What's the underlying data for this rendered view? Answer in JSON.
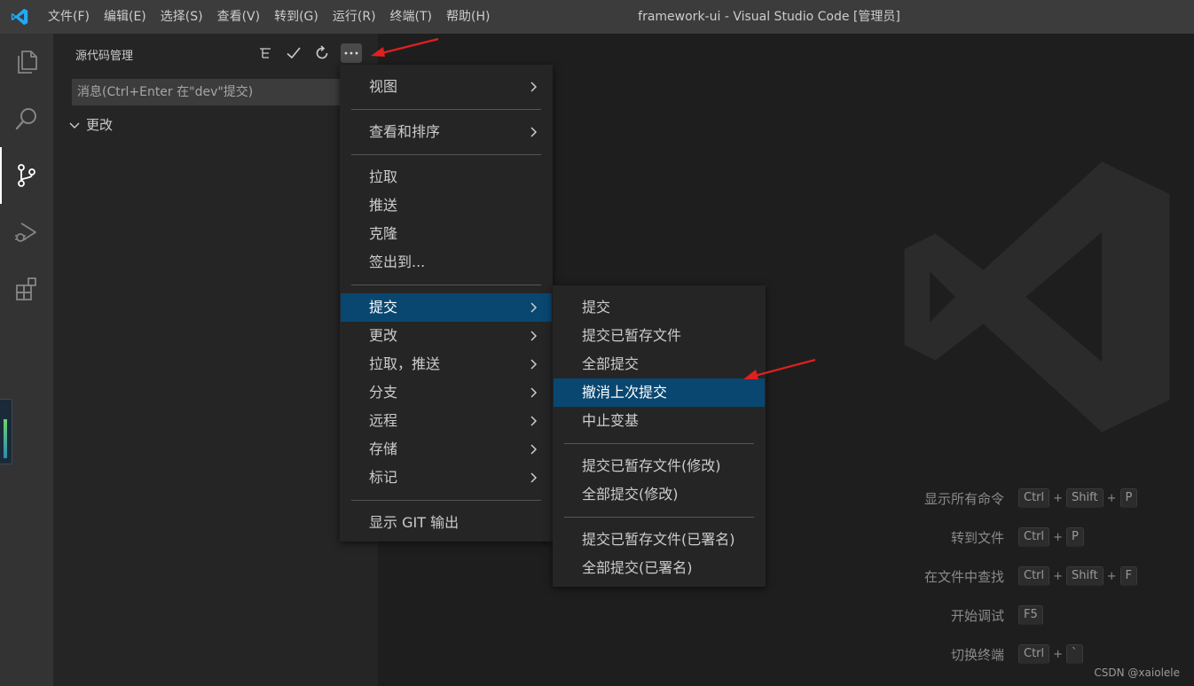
{
  "titlebar": {
    "window_title": "framework-ui - Visual Studio Code [管理员]",
    "menus": [
      "文件(F)",
      "编辑(E)",
      "选择(S)",
      "查看(V)",
      "转到(G)",
      "运行(R)",
      "终端(T)",
      "帮助(H)"
    ],
    "logo_icon": "vscode-logo-icon",
    "background": "#3c3c3c"
  },
  "activitybar": {
    "items": [
      {
        "icon": "explorer-icon"
      },
      {
        "icon": "search-icon"
      },
      {
        "icon": "source-control-icon",
        "active": true
      },
      {
        "icon": "run-debug-icon"
      },
      {
        "icon": "extensions-icon"
      }
    ]
  },
  "sidebar": {
    "title": "源代码管理",
    "actions": [
      "tree-view-icon",
      "check-icon",
      "refresh-icon",
      "more-actions-icon"
    ],
    "commit_input_placeholder": "消息(Ctrl+Enter 在\"dev\"提交)",
    "changes_label": "更改"
  },
  "context_menu": {
    "items": [
      {
        "label": "视图",
        "submenu": true
      },
      {
        "separator": true
      },
      {
        "label": "查看和排序",
        "submenu": true
      },
      {
        "separator": true
      },
      {
        "label": "拉取"
      },
      {
        "label": "推送"
      },
      {
        "label": "克隆"
      },
      {
        "label": "签出到..."
      },
      {
        "separator": true
      },
      {
        "label": "提交",
        "submenu": true,
        "active": true
      },
      {
        "label": "更改",
        "submenu": true
      },
      {
        "label": "拉取，推送",
        "submenu": true
      },
      {
        "label": "分支",
        "submenu": true
      },
      {
        "label": "远程",
        "submenu": true
      },
      {
        "label": "存储",
        "submenu": true
      },
      {
        "label": "标记",
        "submenu": true
      },
      {
        "separator": true
      },
      {
        "label": "显示 GIT 输出"
      }
    ]
  },
  "submenu": {
    "items": [
      {
        "label": "提交"
      },
      {
        "label": "提交已暂存文件"
      },
      {
        "label": "全部提交"
      },
      {
        "label": "撤消上次提交",
        "active": true
      },
      {
        "label": "中止变基"
      },
      {
        "separator": true
      },
      {
        "label": "提交已暂存文件(修改)"
      },
      {
        "label": "全部提交(修改)"
      },
      {
        "separator": true
      },
      {
        "label": "提交已暂存文件(已署名)"
      },
      {
        "label": "全部提交(已署名)"
      }
    ]
  },
  "shortcuts": [
    {
      "label": "显示所有命令",
      "keys": [
        "Ctrl",
        "Shift",
        "P"
      ]
    },
    {
      "label": "转到文件",
      "keys": [
        "Ctrl",
        "P"
      ]
    },
    {
      "label": "在文件中查找",
      "keys": [
        "Ctrl",
        "Shift",
        "F"
      ]
    },
    {
      "label": "开始调试",
      "keys": [
        "F5"
      ]
    },
    {
      "label": "切换终端",
      "keys": [
        "Ctrl",
        "`"
      ]
    }
  ],
  "watermark_text": "CSDN @xaiolele",
  "colors": {
    "menu_active": "#094771",
    "annotation_arrow": "#e02020"
  }
}
